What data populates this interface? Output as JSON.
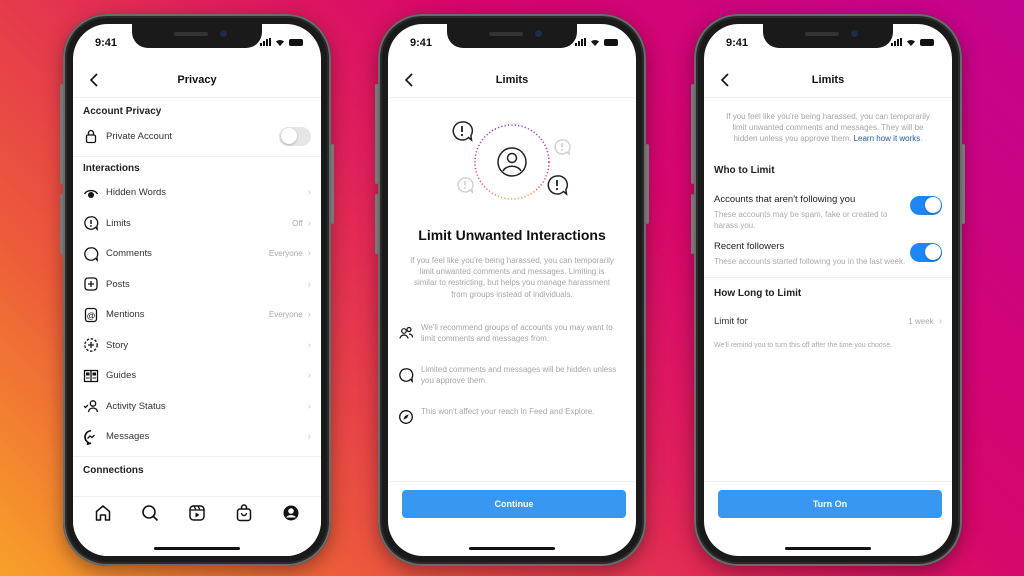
{
  "status_time": "9:41",
  "privacy": {
    "title": "Privacy",
    "account_section": "Account Privacy",
    "private_account": {
      "label": "Private Account",
      "enabled": false
    },
    "interactions_section": "Interactions",
    "items": [
      {
        "label": "Hidden Words",
        "value": "",
        "icon": "eye-icon"
      },
      {
        "label": "Limits",
        "value": "Off",
        "icon": "limits-icon"
      },
      {
        "label": "Comments",
        "value": "Everyone",
        "icon": "comment-icon"
      },
      {
        "label": "Posts",
        "value": "",
        "icon": "plus-square-icon"
      },
      {
        "label": "Mentions",
        "value": "Everyone",
        "icon": "at-icon"
      },
      {
        "label": "Story",
        "value": "",
        "icon": "story-icon"
      },
      {
        "label": "Guides",
        "value": "",
        "icon": "guides-icon"
      },
      {
        "label": "Activity Status",
        "value": "",
        "icon": "activity-status-icon"
      },
      {
        "label": "Messages",
        "value": "",
        "icon": "messenger-icon"
      }
    ],
    "connections_section": "Connections",
    "tabbar": [
      "home-icon",
      "search-icon",
      "reels-icon",
      "shop-icon",
      "profile-icon"
    ]
  },
  "limits_intro": {
    "title": "Limits",
    "headline": "Limit Unwanted Interactions",
    "description": "If you feel like you're being harassed, you can temporarily limit unwanted comments and messages. Limiting is similar to restricting, but helps you manage harassment from groups instead of individuals.",
    "bullets": [
      {
        "icon": "people-icon",
        "text": "We'll recommend groups of accounts you may want to limit comments and messages from."
      },
      {
        "icon": "comment-icon",
        "text": "Limited comments and messages will be hidden unless you approve them."
      },
      {
        "icon": "compass-icon",
        "text": "This won't affect your reach in Feed and Explore."
      }
    ],
    "continue_label": "Continue"
  },
  "limits_settings": {
    "title": "Limits",
    "intro": "If you feel like you're being harassed, you can temporarily limit unwanted comments and messages. They will be hidden unless you approve them.",
    "learn_link": "Learn how it works",
    "who_section": "Who to Limit",
    "options": [
      {
        "title": "Accounts that aren't following you",
        "subtitle": "These accounts may be spam, fake or created to harass you.",
        "enabled": true
      },
      {
        "title": "Recent followers",
        "subtitle": "These accounts started following you in the last week.",
        "enabled": true
      }
    ],
    "how_long_section": "How Long to Limit",
    "limit_for_label": "Limit for",
    "limit_for_value": "1 week",
    "reminder": "We'll remind you to turn this off after the time you choose.",
    "turn_on_label": "Turn On"
  },
  "colors": {
    "accent": "#3897f0",
    "toggle_on": "#1f86f5",
    "link": "#1d5a9c"
  }
}
